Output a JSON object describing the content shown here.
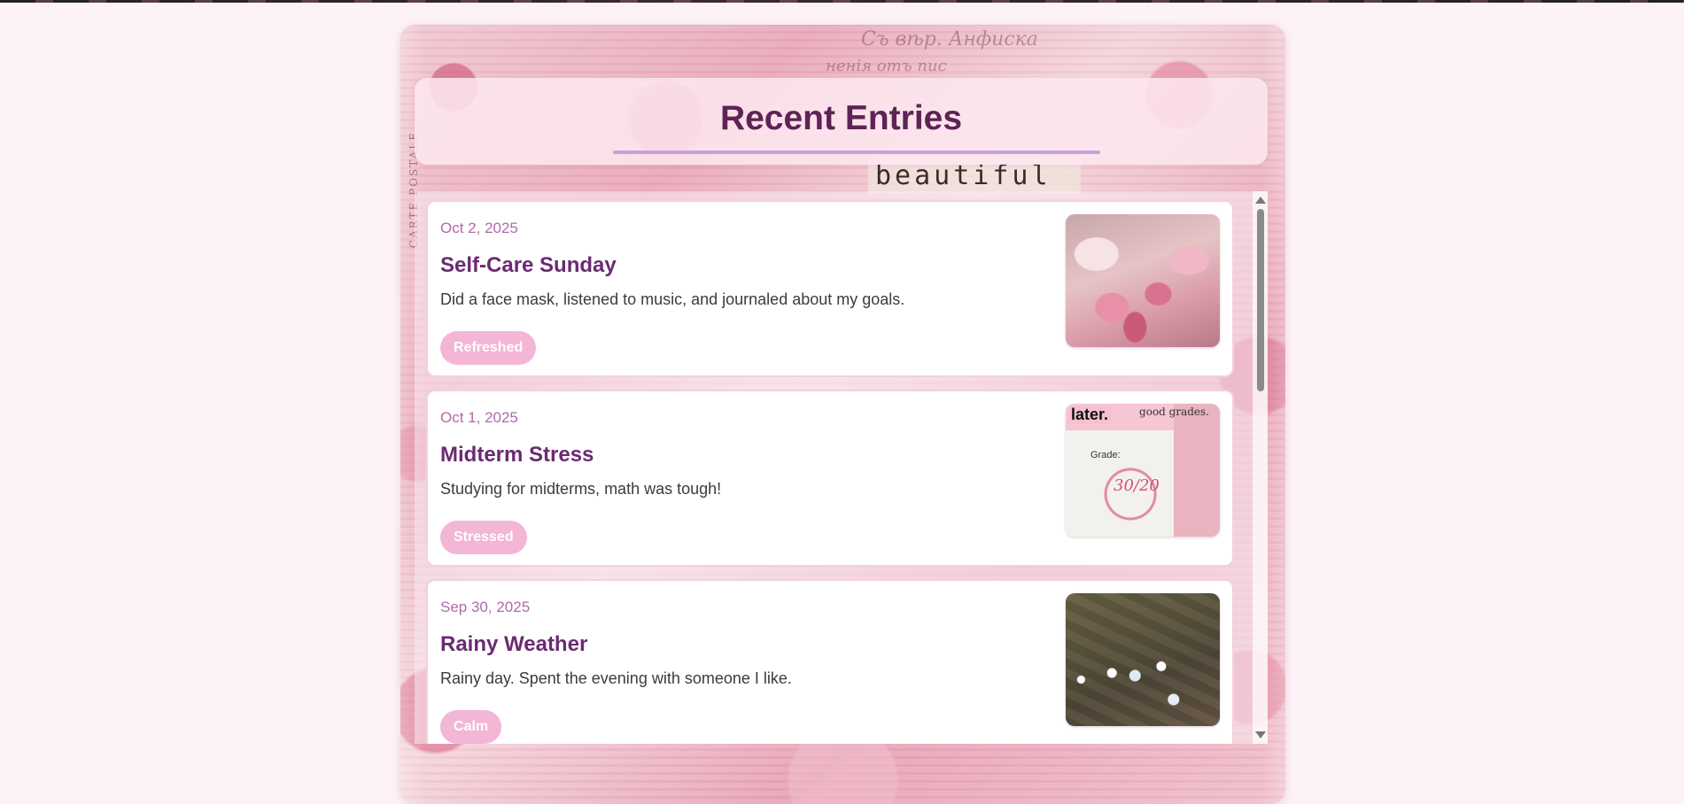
{
  "page": {
    "header": {
      "title": "Recent Entries"
    },
    "decor": {
      "stamp_word": "beautiful",
      "script_line_1": "Съ вѣр. Анфиска",
      "script_line_2": "ненія отъ пис",
      "side_text": "CARTE POSTALE"
    },
    "entries": [
      {
        "date": "Oct 2, 2025",
        "title": "Self-Care Sunday",
        "body": "Did a face mask, listened to music, and journaled about my goals.",
        "mood": "Refreshed",
        "image_alt": "pink makeup products"
      },
      {
        "date": "Oct 1, 2025",
        "title": "Midterm Stress",
        "body": "Studying for midterms, math was tough!",
        "mood": "Stressed",
        "image_alt": "graded test paper",
        "image_text": {
          "later": "later.",
          "good_grades": "good grades.",
          "grade": "Grade:",
          "mark": "30/20"
        }
      },
      {
        "date": "Sep 30, 2025",
        "title": "Rainy Weather",
        "body": "Rainy day. Spent the evening with someone I like.",
        "mood": "Calm",
        "image_alt": "white flowers on wet pavement"
      }
    ],
    "colors": {
      "title": "#5e2356",
      "entry_title": "#6a2a72",
      "date": "#b26aa8",
      "tag_bg": "#f3b6d6",
      "underline": "#caa0dc"
    },
    "scrollbar": {
      "thumb_fraction": 0.33
    }
  }
}
